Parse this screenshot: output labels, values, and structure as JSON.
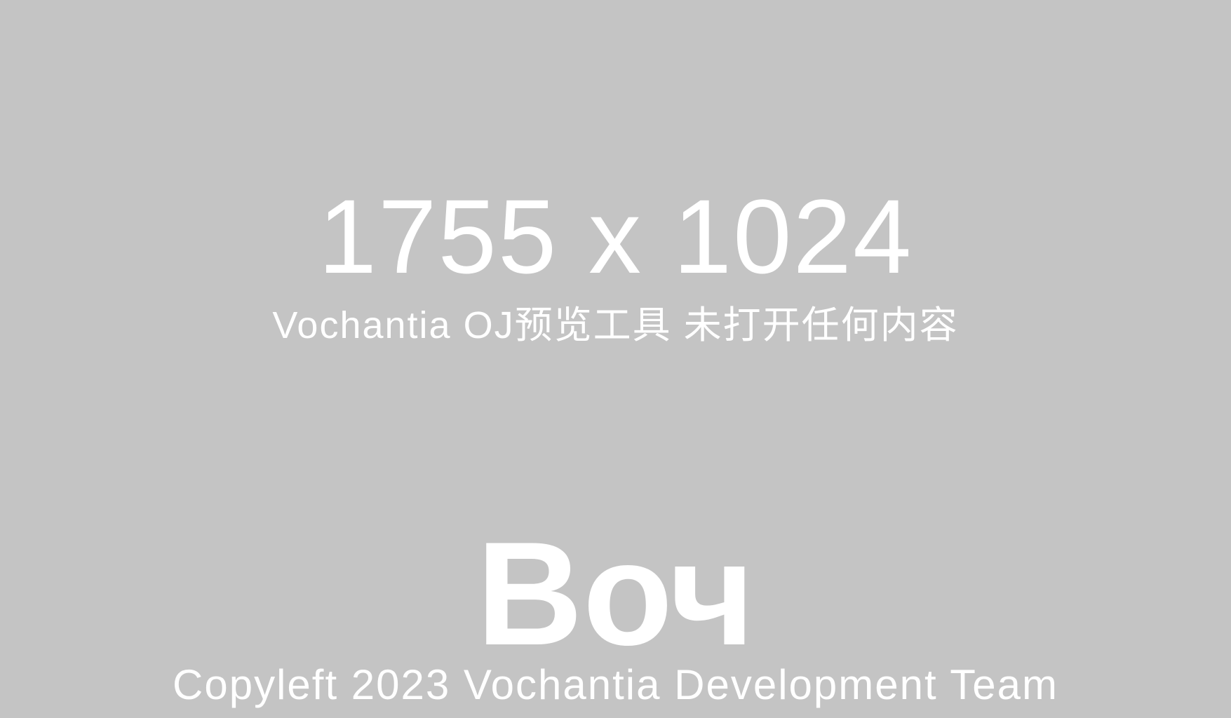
{
  "placeholder": {
    "dimensions": "1755 x 1024",
    "subtitle": "Vochantia OJ预览工具 未打开任何内容",
    "logo_text": "Воч",
    "copyright": "Copyleft 2023 Vochantia Development Team",
    "background_color": "#c4c4c4",
    "text_color": "#ffffff"
  }
}
